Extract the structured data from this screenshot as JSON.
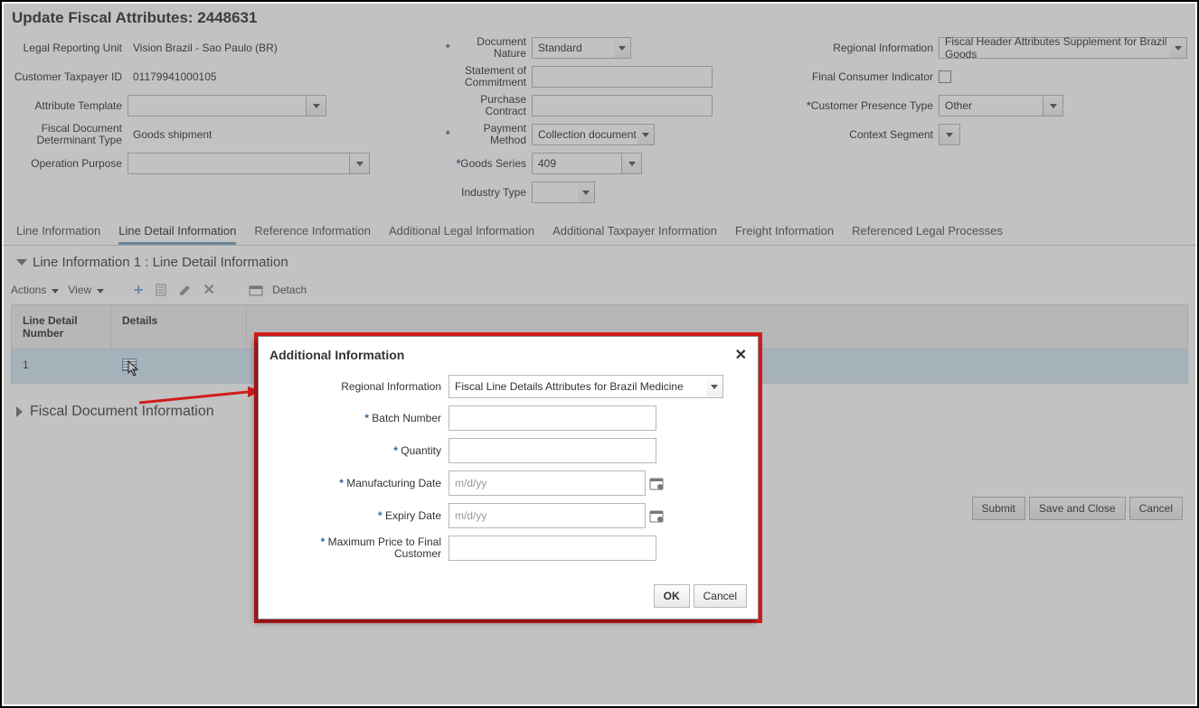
{
  "header": {
    "title": "Update Fiscal Attributes: 2448631"
  },
  "form": {
    "col1": {
      "legal_unit_label": "Legal Reporting Unit",
      "legal_unit_value": "Vision Brazil - Sao Paulo (BR)",
      "customer_tax_label": "Customer Taxpayer ID",
      "customer_tax_value": "01179941000105",
      "attribute_template_label": "Attribute Template",
      "attribute_template_value": "",
      "fiscal_doc_det_label": "Fiscal Document Determinant Type",
      "fiscal_doc_det_value": "Goods shipment",
      "operation_purpose_label": "Operation Purpose",
      "operation_purpose_value": ""
    },
    "col2": {
      "document_nature_label": "Document Nature",
      "document_nature_value": "Standard",
      "statement_commit_label": "Statement of Commitment",
      "purchase_contract_label": "Purchase Contract",
      "payment_method_label": "Payment Method",
      "payment_method_value": "Collection document",
      "goods_series_label": "Goods Series",
      "goods_series_value": "409",
      "industry_type_label": "Industry Type",
      "industry_type_value": ""
    },
    "col3": {
      "regional_info_label": "Regional Information",
      "regional_info_value": "Fiscal Header Attributes Supplement for Brazil Goods",
      "final_consumer_label": "Final Consumer Indicator",
      "customer_presence_label": "Customer Presence Type",
      "customer_presence_value": "Other",
      "context_segment_label": "Context Segment",
      "context_segment_value": ""
    }
  },
  "tabs": {
    "t0": "Line Information",
    "t1": "Line Detail Information",
    "t2": "Reference Information",
    "t3": "Additional Legal Information",
    "t4": "Additional Taxpayer Information",
    "t5": "Freight Information",
    "t6": "Referenced Legal Processes"
  },
  "section": {
    "title": "Line Information 1 : Line Detail Information",
    "actions": "Actions",
    "view": "View",
    "detach": "Detach"
  },
  "table": {
    "col1": "Line Detail Number",
    "col2": "Details",
    "row1_num": "1"
  },
  "sub": {
    "fiscal_doc_info": "Fiscal Document Information"
  },
  "footer": {
    "submit": "Submit",
    "save_close": "Save and Close",
    "cancel": "Cancel"
  },
  "modal": {
    "title": "Additional Information",
    "regional_info_label": "Regional Information",
    "regional_info_value": "Fiscal Line Details Attributes for Brazil Medicine",
    "batch_label": "Batch Number",
    "qty_label": "Quantity",
    "mfg_label": "Manufacturing Date",
    "mfg_placeholder": "m/d/yy",
    "exp_label": "Expiry Date",
    "exp_placeholder": "m/d/yy",
    "max_price_label": "Maximum Price to Final Customer",
    "ok": "OK",
    "cancel": "Cancel"
  }
}
